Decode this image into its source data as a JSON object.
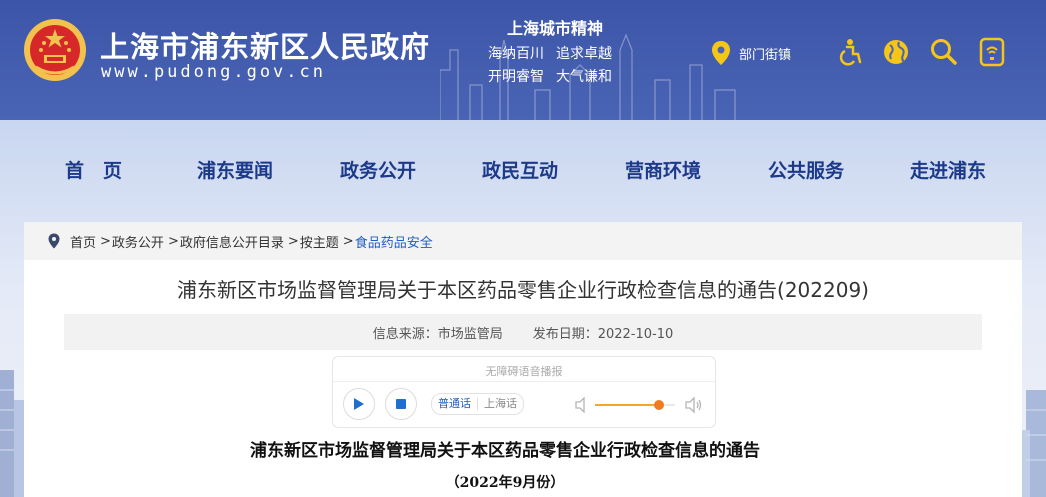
{
  "header": {
    "site_title": "上海市浦东新区人民政府",
    "site_url": "www.pudong.gov.cn",
    "spirit_title": "上海城市精神",
    "spirit_lines": [
      [
        "海纳百川",
        "追求卓越"
      ],
      [
        "开明睿智",
        "大气谦和"
      ]
    ],
    "dept_link": "部门街镇",
    "icons": [
      "location-pin-icon",
      "accessibility-icon",
      "globe-icon",
      "search-icon",
      "mobile-icon"
    ]
  },
  "nav": {
    "items": [
      "首　页",
      "浦东要闻",
      "政务公开",
      "政民互动",
      "营商环境",
      "公共服务",
      "走进浦东"
    ]
  },
  "breadcrumb": {
    "items": [
      "首页",
      "政务公开",
      "政府信息公开目录",
      "按主题",
      "食品药品安全"
    ],
    "separator": ">"
  },
  "article": {
    "title": "浦东新区市场监督管理局关于本区药品零售企业行政检查信息的通告(202209)",
    "source": "信息来源：市场监管局",
    "date": "发布日期：2022-10-10"
  },
  "player": {
    "title": "无障碍语音播报",
    "languages": [
      "普通话",
      "上海话"
    ],
    "active_language": "普通话",
    "volume": 0.8
  },
  "document": {
    "heading": "浦东新区市场监督管理局关于本区药品零售企业行政检查信息的通告",
    "subheading": "（2022年9月份）"
  },
  "colors": {
    "header_bg": "#4a64b5",
    "nav_text": "#1d3a8a",
    "link_blue": "#1f5fbf",
    "volume_accent": "#f07a1e"
  }
}
